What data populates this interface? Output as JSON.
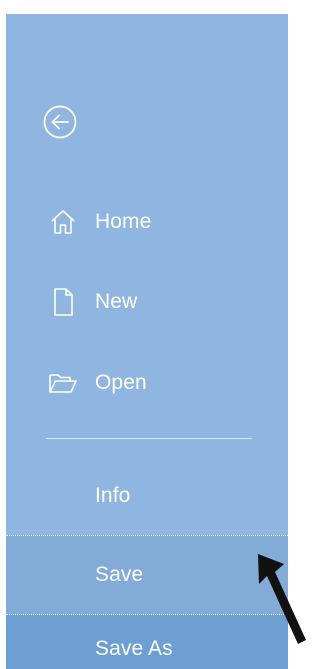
{
  "backstage": {
    "back_icon": "back-arrow-circle-icon",
    "items": [
      {
        "label": "Home",
        "icon": "home-icon"
      },
      {
        "label": "New",
        "icon": "new-document-icon"
      },
      {
        "label": "Open",
        "icon": "open-folder-icon"
      },
      {
        "label": "Info"
      },
      {
        "label": "Save"
      },
      {
        "label": "Save As"
      }
    ]
  },
  "colors": {
    "sidebar": "#8fb6e0",
    "hover": "#82abd8",
    "selected": "#6d9fd2",
    "text": "#ffffff"
  }
}
